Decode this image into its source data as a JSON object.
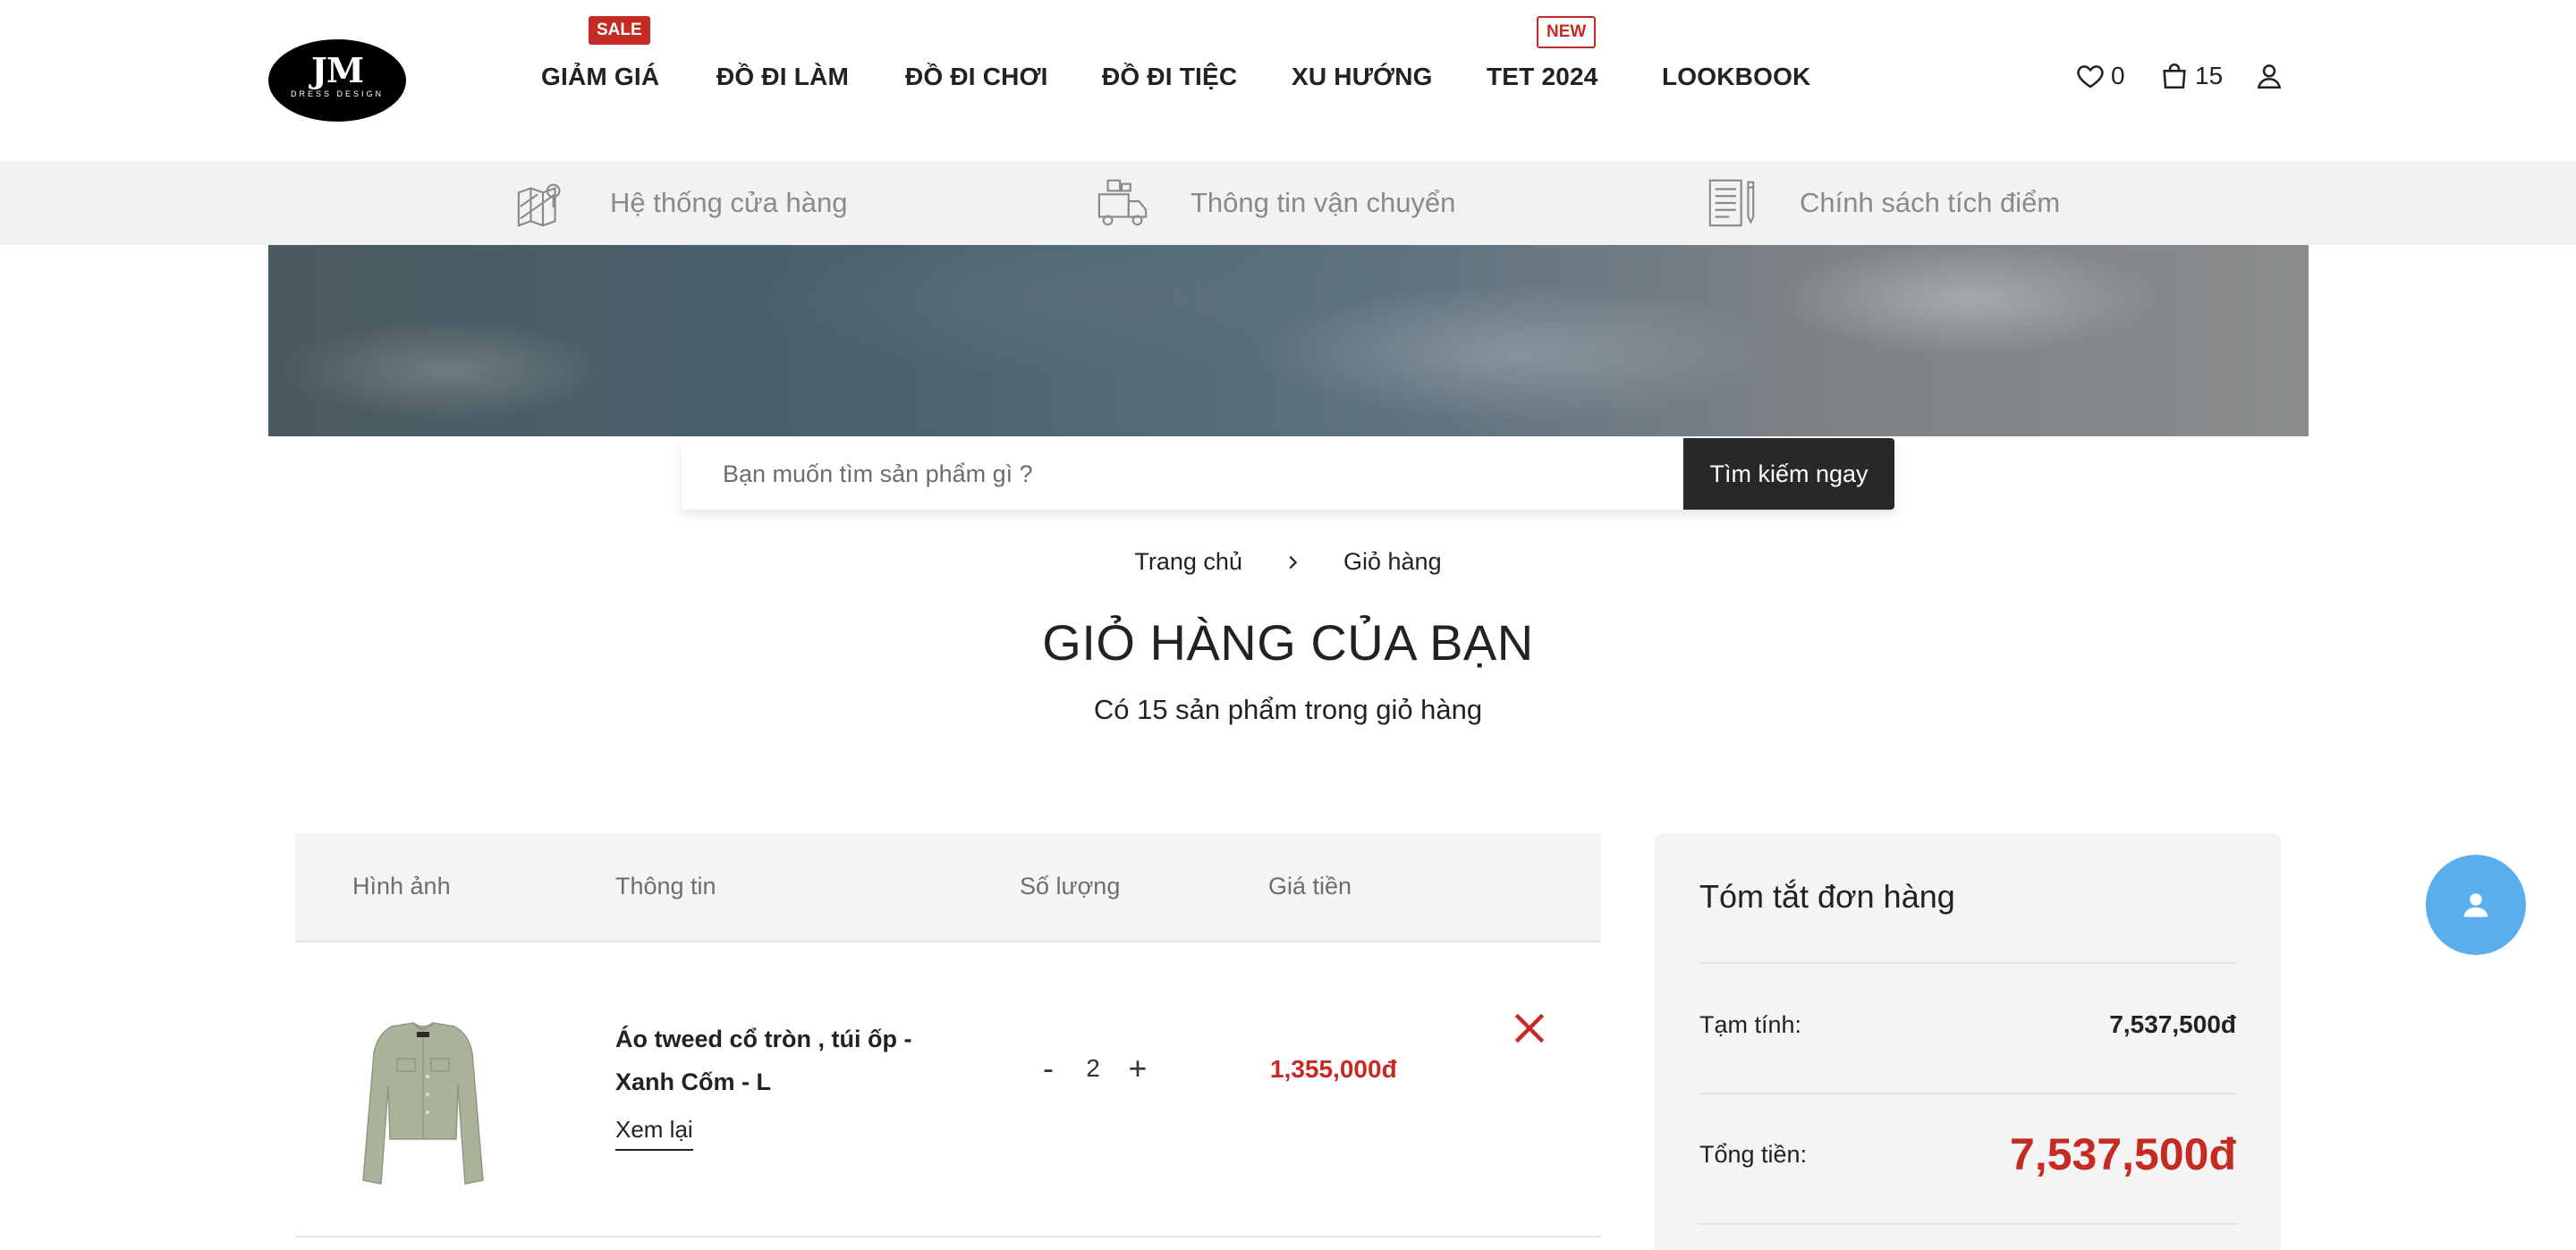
{
  "logo": {
    "mark": "JM",
    "sub": "DRESS DESIGN"
  },
  "nav": {
    "items": [
      {
        "label": "GIẢM GIÁ"
      },
      {
        "label": "ĐỒ ĐI LÀM"
      },
      {
        "label": "ĐỒ ĐI CHƠI"
      },
      {
        "label": "ĐỒ ĐI TIỆC"
      },
      {
        "label": "XU HƯỚNG"
      },
      {
        "label": "TET 2024"
      },
      {
        "label": "LOOKBOOK"
      }
    ],
    "badges": {
      "sale": "SALE",
      "new": "NEW"
    }
  },
  "header_icons": {
    "wishlist_count": "0",
    "cart_count": "15"
  },
  "infobar": {
    "items": [
      {
        "label": "Hệ thống cửa hàng",
        "icon": "map-icon"
      },
      {
        "label": "Thông tin vận chuyển",
        "icon": "truck-icon"
      },
      {
        "label": "Chính sách tích điểm",
        "icon": "document-icon"
      }
    ]
  },
  "search": {
    "placeholder": "Bạn muốn tìm sản phẩm gì ?",
    "button": "Tìm kiếm ngay"
  },
  "breadcrumb": {
    "home": "Trang chủ",
    "current": "Giỏ hàng"
  },
  "page": {
    "title": "GIỎ HÀNG CỦA BẠN",
    "subtitle": "Có 15 sản phẩm trong giỏ hàng"
  },
  "cart": {
    "columns": {
      "image": "Hình ảnh",
      "info": "Thông tin",
      "qty": "Số lượng",
      "price": "Giá tiền"
    },
    "items": [
      {
        "name": "Áo tweed cổ tròn , túi ốp - Xanh Cốm - L",
        "review": "Xem lại",
        "qty_minus": "-",
        "qty": "2",
        "qty_plus": "+",
        "price": "1,355,000đ",
        "color": "#a9b39a"
      }
    ]
  },
  "summary": {
    "title": "Tóm tắt đơn hàng",
    "subtotal_label": "Tạm tính:",
    "subtotal": "7,537,500đ",
    "total_label": "Tổng tiền:",
    "total": "7,537,500đ"
  },
  "colors": {
    "accent_red": "#c52a23",
    "dark_button": "#282828",
    "float_blue": "#5aaeee"
  }
}
